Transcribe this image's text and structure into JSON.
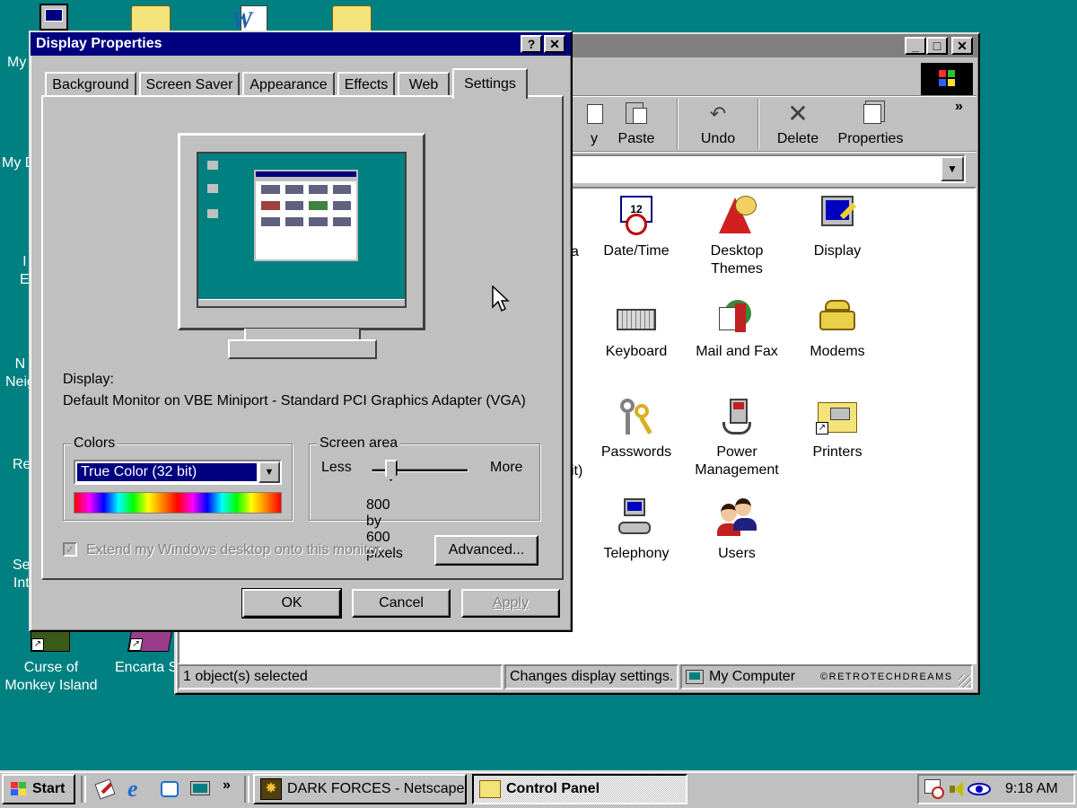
{
  "desktop": {
    "icons": [
      {
        "label": "My"
      },
      {
        "label": "My D"
      },
      {
        "label": "I\nE"
      },
      {
        "label": "N\nNeig"
      },
      {
        "label": "Re"
      },
      {
        "label": "Se\nInt"
      },
      {
        "label": "Curse of\nMonkey Island"
      },
      {
        "label": "Encarta S"
      }
    ]
  },
  "control_panel": {
    "title": "",
    "window_buttons": {
      "minimize": "_",
      "maximize": "□",
      "close": "✕"
    },
    "toolbar": {
      "partial_label": "y",
      "paste": "Paste",
      "undo": "Undo",
      "delete": "Delete",
      "properties": "Properties",
      "more": "»"
    },
    "address_dropdown": "▼",
    "partial_labels": {
      "a": "a",
      "it": "it)"
    },
    "items": [
      {
        "label": "Date/Time",
        "icon": "clock-calendar-icon"
      },
      {
        "label": "Desktop\nThemes",
        "icon": "themes-icon"
      },
      {
        "label": "Display",
        "icon": "monitor-icon"
      },
      {
        "label": "Keyboard",
        "icon": "keyboard-icon"
      },
      {
        "label": "Mail and Fax",
        "icon": "mail-fax-icon"
      },
      {
        "label": "Modems",
        "icon": "modem-phone-icon"
      },
      {
        "label": "Passwords",
        "icon": "keys-icon"
      },
      {
        "label": "Power\nManagement",
        "icon": "power-plug-icon"
      },
      {
        "label": "Printers",
        "icon": "printer-folder-icon"
      },
      {
        "label": "Telephony",
        "icon": "telephony-icon"
      },
      {
        "label": "Users",
        "icon": "users-icon"
      }
    ],
    "status": {
      "selected": "1 object(s) selected",
      "description": "Changes display settings.",
      "location": "My Computer",
      "watermark": "©RETROTECHDREAMS"
    }
  },
  "dialog": {
    "title": "Display Properties",
    "help_button": "?",
    "close_button": "✕",
    "tabs": [
      "Background",
      "Screen Saver",
      "Appearance",
      "Effects",
      "Web",
      "Settings"
    ],
    "selected_tab": "Settings",
    "display_label": "Display:",
    "display_value": "Default Monitor on VBE Miniport - Standard PCI Graphics Adapter (VGA)",
    "colors_group": "Colors",
    "colors_value": "True Color (32 bit)",
    "screen_area_group": "Screen area",
    "screen_area_less": "Less",
    "screen_area_more": "More",
    "screen_area_value": "800 by 600 pixels",
    "slider_level": 0.2,
    "extend_checkbox": "Extend my Windows desktop onto this monitor.",
    "extend_checked": true,
    "advanced_button": "Advanced...",
    "ok_button": "OK",
    "cancel_button": "Cancel",
    "apply_button": "Apply"
  },
  "taskbar": {
    "start": "Start",
    "chevron": "»",
    "tasks": [
      {
        "label": "DARK FORCES - Netscape",
        "active": false
      },
      {
        "label": "Control Panel",
        "active": true
      }
    ],
    "clock": "9:18 AM"
  },
  "colors": {
    "desktop": "#008080",
    "title_active": "#000080",
    "face": "#c0c0c0"
  }
}
